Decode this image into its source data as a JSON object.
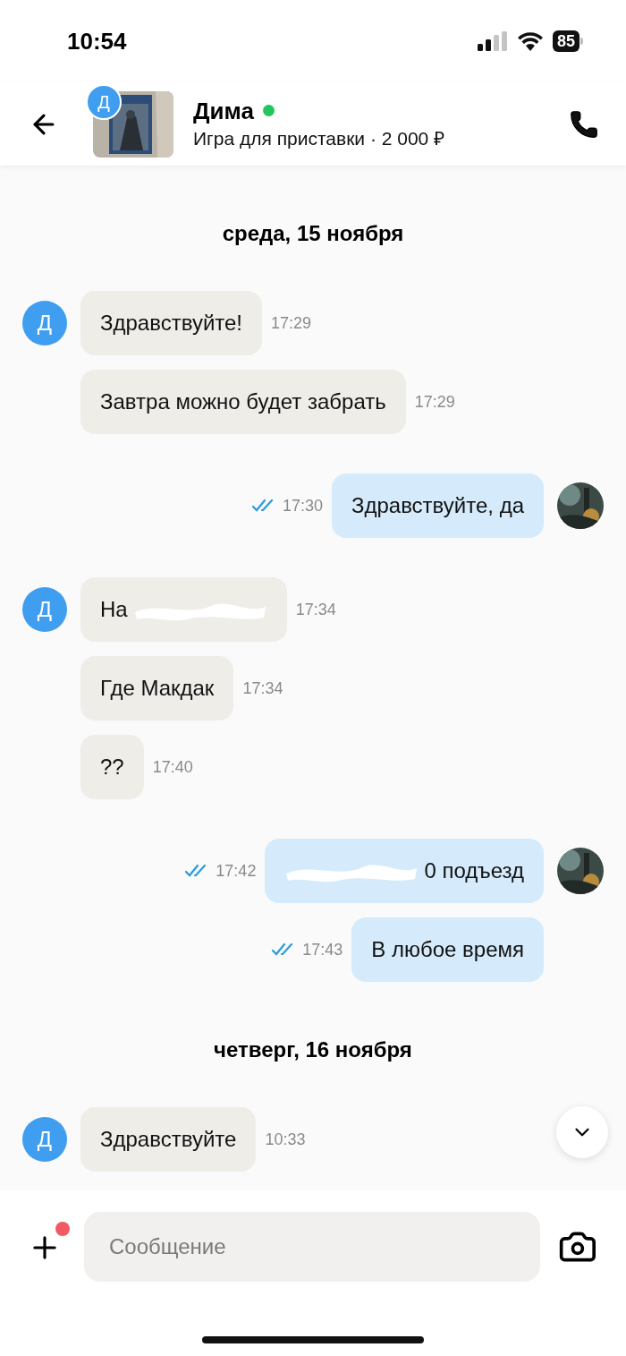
{
  "status_bar": {
    "time": "10:54",
    "battery": "85"
  },
  "header": {
    "avatar_letter": "Д",
    "name": "Дима",
    "online": true,
    "subtitle": "Игра для приставки · 2 000 ₽"
  },
  "messages": [
    {
      "kind": "date",
      "text": "среда, 15 ноября"
    },
    {
      "kind": "in",
      "avatar": true,
      "avatar_letter": "Д",
      "text": "Здравствуйте!",
      "time": "17:29"
    },
    {
      "kind": "in",
      "avatar": false,
      "text": "Завтра можно будет забрать",
      "time": "17:29"
    },
    {
      "kind": "out",
      "avatar": true,
      "read": true,
      "text": "Здравствуйте, да",
      "time": "17:30"
    },
    {
      "kind": "in",
      "avatar": true,
      "avatar_letter": "Д",
      "text": "На",
      "redacted_after": true,
      "time": "17:34"
    },
    {
      "kind": "in",
      "avatar": false,
      "text": "Где Макдак",
      "time": "17:34"
    },
    {
      "kind": "in",
      "avatar": false,
      "text": "??",
      "time": "17:40"
    },
    {
      "kind": "out",
      "avatar": true,
      "read": true,
      "text": "0 подъезд",
      "redacted_before": true,
      "time": "17:42"
    },
    {
      "kind": "out",
      "avatar": false,
      "read": true,
      "text": "В любое время",
      "time": "17:43"
    },
    {
      "kind": "date",
      "text": "четверг, 16 ноября"
    },
    {
      "kind": "in",
      "avatar": true,
      "avatar_letter": "Д",
      "text": "Здравствуйте",
      "time": "10:33"
    }
  ],
  "composer": {
    "placeholder": "Сообщение",
    "attachment_badge": true
  }
}
